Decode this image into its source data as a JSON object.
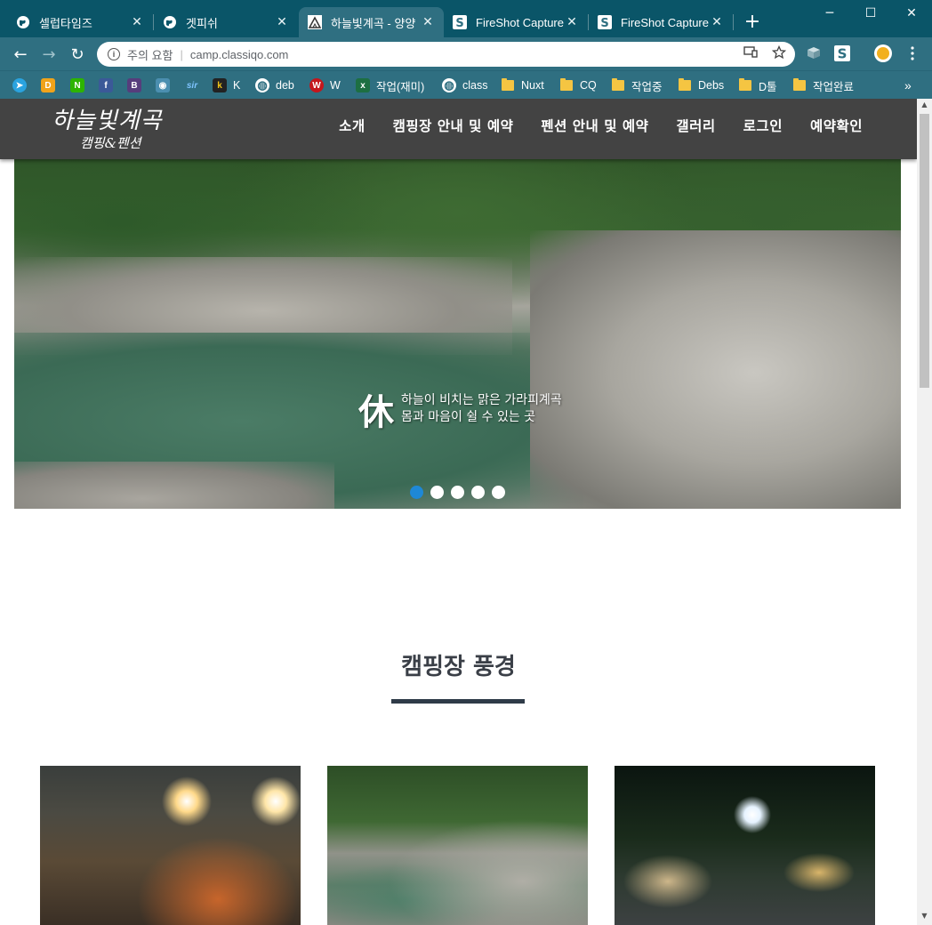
{
  "browser": {
    "tabs": [
      {
        "title": "셀럽타임즈",
        "icon": "globe-icon",
        "active": false
      },
      {
        "title": "겟피쉬",
        "icon": "globe-icon",
        "active": false
      },
      {
        "title": "하늘빛계곡 - 양양",
        "icon": "mountain-icon",
        "active": true
      },
      {
        "title": "FireShot Capture",
        "icon": "fireshot-icon",
        "active": false
      },
      {
        "title": "FireShot Capture",
        "icon": "fireshot-icon",
        "active": false
      }
    ],
    "close_glyph": "✕",
    "new_tab_glyph": "+",
    "window": {
      "minimize": "─",
      "maximize": "☐",
      "close": "✕"
    },
    "nav": {
      "back": "←",
      "forward": "→",
      "reload": "↻"
    },
    "omnibox": {
      "info_glyph": "i",
      "security_label": "주의 요함",
      "separator": "|",
      "url": "camp.classiqo.com"
    },
    "bookmarks": [
      {
        "label": "",
        "icon": "telegram-icon",
        "color": "#2aa3df",
        "glyph": "➤"
      },
      {
        "label": "",
        "icon": "d-icon",
        "color": "#f0a31a",
        "glyph": "D"
      },
      {
        "label": "",
        "icon": "naver-icon",
        "color": "#2db400",
        "glyph": "N"
      },
      {
        "label": "",
        "icon": "facebook-icon",
        "color": "#3b5998",
        "glyph": "f"
      },
      {
        "label": "",
        "icon": "bootstrap-icon",
        "color": "#563d7c",
        "glyph": "B"
      },
      {
        "label": "",
        "icon": "image-icon",
        "color": "#4b8fb0",
        "glyph": "◉"
      },
      {
        "label": "",
        "icon": "sir-icon",
        "color": "#2f6f81",
        "glyph": "sir"
      },
      {
        "label": "K",
        "icon": "k-icon",
        "color": "#222222",
        "glyph": "k"
      },
      {
        "label": "deb",
        "icon": "globe-icon",
        "color": "#2f6f81",
        "glyph": "◍"
      },
      {
        "label": "W",
        "icon": "w-icon",
        "color": "#c4161c",
        "glyph": "W"
      },
      {
        "label": "작업(재미)",
        "icon": "excel-icon",
        "color": "#1d6f42",
        "glyph": "x"
      },
      {
        "label": "class",
        "icon": "globe-icon",
        "color": "#2f6f81",
        "glyph": "◍"
      },
      {
        "label": "Nuxt",
        "icon": "folder-icon",
        "color": "#f5c542",
        "glyph": ""
      },
      {
        "label": "CQ",
        "icon": "folder-icon",
        "color": "#f5c542",
        "glyph": ""
      },
      {
        "label": "작업중",
        "icon": "folder-icon",
        "color": "#f5c542",
        "glyph": ""
      },
      {
        "label": "Debs",
        "icon": "folder-icon",
        "color": "#f5c542",
        "glyph": ""
      },
      {
        "label": "D툴",
        "icon": "folder-icon",
        "color": "#f5c542",
        "glyph": ""
      },
      {
        "label": "작업완료",
        "icon": "folder-icon",
        "color": "#f5c542",
        "glyph": ""
      }
    ],
    "bookmarks_overflow": "»"
  },
  "site": {
    "logo_line1": "하늘빛계곡",
    "logo_line2": "캠핑&펜션",
    "nav": [
      "소개",
      "캠핑장 안내 및 예약",
      "펜션 안내 및 예약",
      "갤러리",
      "로그인",
      "예약확인"
    ],
    "hero": {
      "hanja": "休",
      "line1": "하늘이 비치는 맑은 가라피계곡",
      "line2": "몸과 마음이 쉴 수 있는 곳",
      "slide_count": 5,
      "active_slide": 1
    },
    "section_title": "캠핑장 풍경",
    "gallery": [
      "camping-night-tent-photo",
      "valley-stream-photo",
      "campsite-night-photo"
    ]
  },
  "colors": {
    "chrome": "#0a5568",
    "toolbar": "#2f6f81",
    "site_header": "#434343",
    "dot_active": "#1e88d6",
    "underline": "#2f3b48"
  }
}
